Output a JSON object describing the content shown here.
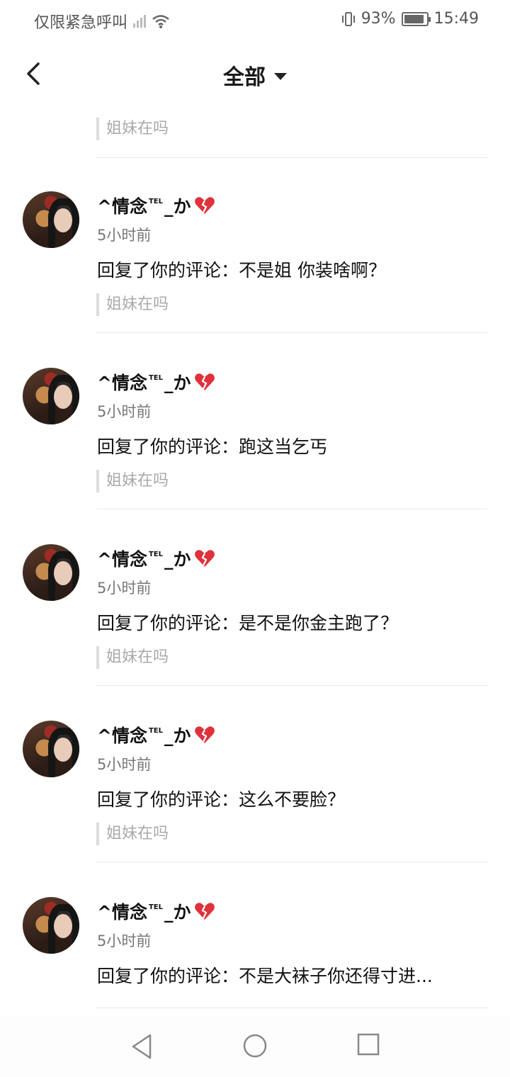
{
  "status_bar": {
    "carrier": "仅限紧急呼叫",
    "battery_percent": "93%",
    "battery_level": 0.93,
    "time": "15:49"
  },
  "nav": {
    "title": "全部"
  },
  "top_quote": "姐妹在吗",
  "items": [
    {
      "username": "^情念",
      "tel": "TEL",
      "suffix": "_か",
      "time": "5小时前",
      "comment": "回复了你的评论：不是姐 你装啥啊？",
      "quote": "姐妹在吗"
    },
    {
      "username": "^情念",
      "tel": "TEL",
      "suffix": "_か",
      "time": "5小时前",
      "comment": "回复了你的评论：跑这当乞丐",
      "quote": "姐妹在吗"
    },
    {
      "username": "^情念",
      "tel": "TEL",
      "suffix": "_か",
      "time": "5小时前",
      "comment": "回复了你的评论：是不是你金主跑了？",
      "quote": "姐妹在吗"
    },
    {
      "username": "^情念",
      "tel": "TEL",
      "suffix": "_か",
      "time": "5小时前",
      "comment": "回复了你的评论：这么不要脸？",
      "quote": "姐妹在吗"
    },
    {
      "username": "^情念",
      "tel": "TEL",
      "suffix": "_か",
      "time": "5小时前",
      "comment": "回复了你的评论：不是大袜子你还得寸进...",
      "quote": ""
    }
  ],
  "icons": {
    "back": "chevron-left-icon",
    "dropdown": "caret-down-icon",
    "heart": "broken-heart-icon",
    "sys_back": "triangle-back-icon",
    "sys_home": "circle-home-icon",
    "sys_recent": "square-recents-icon"
  },
  "colors": {
    "heart": "#e0323c",
    "quote_text": "#a9a9a9"
  }
}
